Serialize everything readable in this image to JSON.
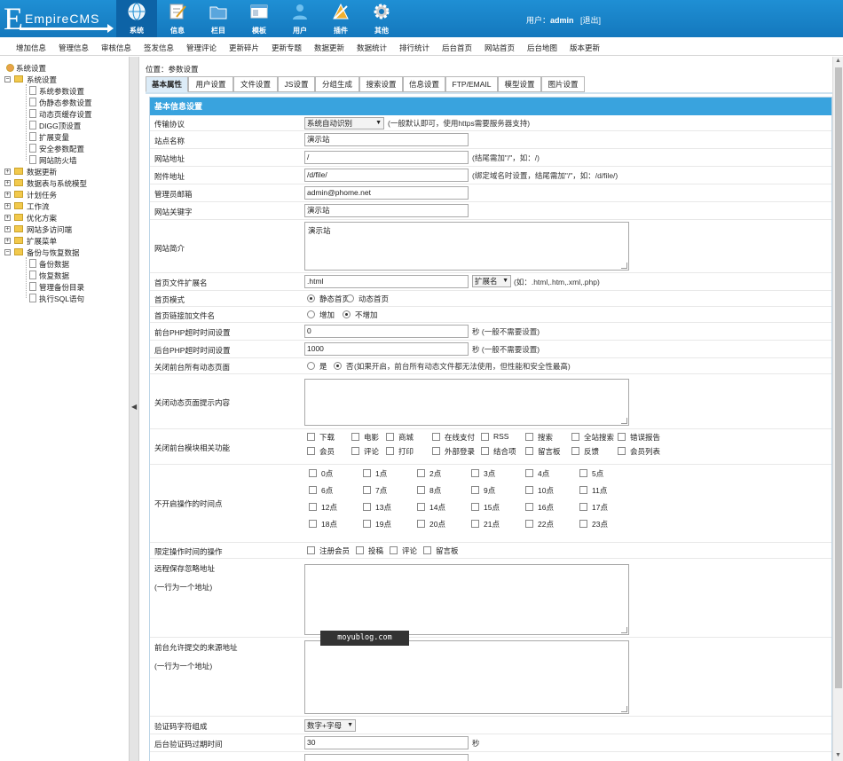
{
  "header": {
    "logo_text": "EmpireCMS",
    "nav": [
      {
        "label": "系统",
        "icon": "globe-icon",
        "active": true
      },
      {
        "label": "信息",
        "icon": "edit-icon"
      },
      {
        "label": "栏目",
        "icon": "folder-icon"
      },
      {
        "label": "模板",
        "icon": "template-icon"
      },
      {
        "label": "用户",
        "icon": "user-icon"
      },
      {
        "label": "插件",
        "icon": "plugin-icon"
      },
      {
        "label": "其他",
        "icon": "gear-icon"
      }
    ],
    "user_label": "用户：",
    "username": "admin",
    "logout": "[退出]"
  },
  "subnav": [
    "增加信息",
    "管理信息",
    "审核信息",
    "签发信息",
    "管理评论",
    "更新碎片",
    "更新专题",
    "数据更新",
    "数据统计",
    "排行统计",
    "后台首页",
    "网站首页",
    "后台地图",
    "版本更新"
  ],
  "sidebar": {
    "root": "系统设置",
    "sys_group": "系统设置",
    "sys_items": [
      "系统参数设置",
      "伪静态参数设置",
      "动态页缓存设置",
      "DIGG顶设置",
      "扩展变量",
      "安全参数配置",
      "网站防火墙"
    ],
    "groups": [
      "数据更新",
      "数据表与系统模型",
      "计划任务",
      "工作流",
      "优化方案",
      "网站多访问端",
      "扩展菜单"
    ],
    "backup_group": "备份与恢复数据",
    "backup_items": [
      "备份数据",
      "恢复数据",
      "管理备份目录",
      "执行SQL语句"
    ]
  },
  "splitter_arrow": "◀",
  "breadcrumb": "位置：参数设置",
  "tabs": [
    "基本属性",
    "用户设置",
    "文件设置",
    "JS设置",
    "分组生成",
    "搜索设置",
    "信息设置",
    "FTP/EMAIL",
    "模型设置",
    "图片设置"
  ],
  "panel_title": "基本信息设置",
  "form": {
    "protocol": {
      "label": "传输协议",
      "value": "系统自动识别",
      "hint": "(一般默认即可，使用https需要服务器支持)"
    },
    "site_name": {
      "label": "站点名称",
      "value": "演示站"
    },
    "site_url": {
      "label": "网站地址",
      "value": "/",
      "hint": "(结尾需加\"/\"，如：/)"
    },
    "attach_url": {
      "label": "附件地址",
      "value": "/d/file/",
      "hint": "(绑定域名时设置，结尾需加\"/\"，如：/d/file/)"
    },
    "admin_email": {
      "label": "管理员邮箱",
      "value": "admin@phome.net"
    },
    "keywords": {
      "label": "网站关键字",
      "value": "演示站"
    },
    "intro": {
      "label": "网站简介",
      "value": "演示站"
    },
    "index_ext": {
      "label": "首页文件扩展名",
      "value": ".html",
      "select": "扩展名",
      "hint": "(如：.html,.htm,.xml,.php)"
    },
    "index_mode": {
      "label": "首页模式",
      "options": [
        "静态首页",
        "动态首页"
      ],
      "selected": 0
    },
    "index_link": {
      "label": "首页链接加文件名",
      "options": [
        "增加",
        "不增加"
      ],
      "selected": 1
    },
    "front_timeout": {
      "label": "前台PHP超时时间设置",
      "value": "0",
      "hint": "秒 (一般不需要设置)"
    },
    "back_timeout": {
      "label": "后台PHP超时时间设置",
      "value": "1000",
      "hint": "秒 (一般不需要设置)"
    },
    "close_dynamic": {
      "label": "关闭前台所有动态页面",
      "options": [
        "是",
        "否"
      ],
      "selected": 1,
      "hint": "(如果开启，前台所有动态文件都无法使用，但性能和安全性最高)"
    },
    "close_tip": {
      "label": "关闭动态页面提示内容"
    },
    "close_modules": {
      "label": "关闭前台模块相关功能",
      "items": [
        "下载",
        "电影",
        "商城",
        "在线支付",
        "RSS",
        "搜索",
        "全站搜索",
        "错误报告",
        "会员",
        "评论",
        "打印",
        "外部登录",
        "结合项",
        "留言板",
        "反馈",
        "会员列表"
      ]
    },
    "no_op_hours": {
      "label": "不开启操作的时间点",
      "hours": [
        "0点",
        "1点",
        "2点",
        "3点",
        "4点",
        "5点",
        "6点",
        "7点",
        "8点",
        "9点",
        "10点",
        "11点",
        "12点",
        "13点",
        "14点",
        "15点",
        "16点",
        "17点",
        "18点",
        "19点",
        "20点",
        "21点",
        "22点",
        "23点"
      ]
    },
    "limit_ops": {
      "label": "限定操作时间的操作",
      "items": [
        "注册会员",
        "投稿",
        "评论",
        "留言板"
      ]
    },
    "remote_ignore": {
      "label": "远程保存忽略地址",
      "sub": "(一行为一个地址)"
    },
    "allowed_sources": {
      "label": "前台允许提交的来源地址",
      "sub": "(一行为一个地址)"
    },
    "captcha_chars": {
      "label": "验证码字符组成",
      "value": "数字+字母"
    },
    "captcha_expire": {
      "label": "后台验证码过期时间",
      "value": "30",
      "hint": "秒"
    }
  },
  "watermark": "moyublog.com"
}
